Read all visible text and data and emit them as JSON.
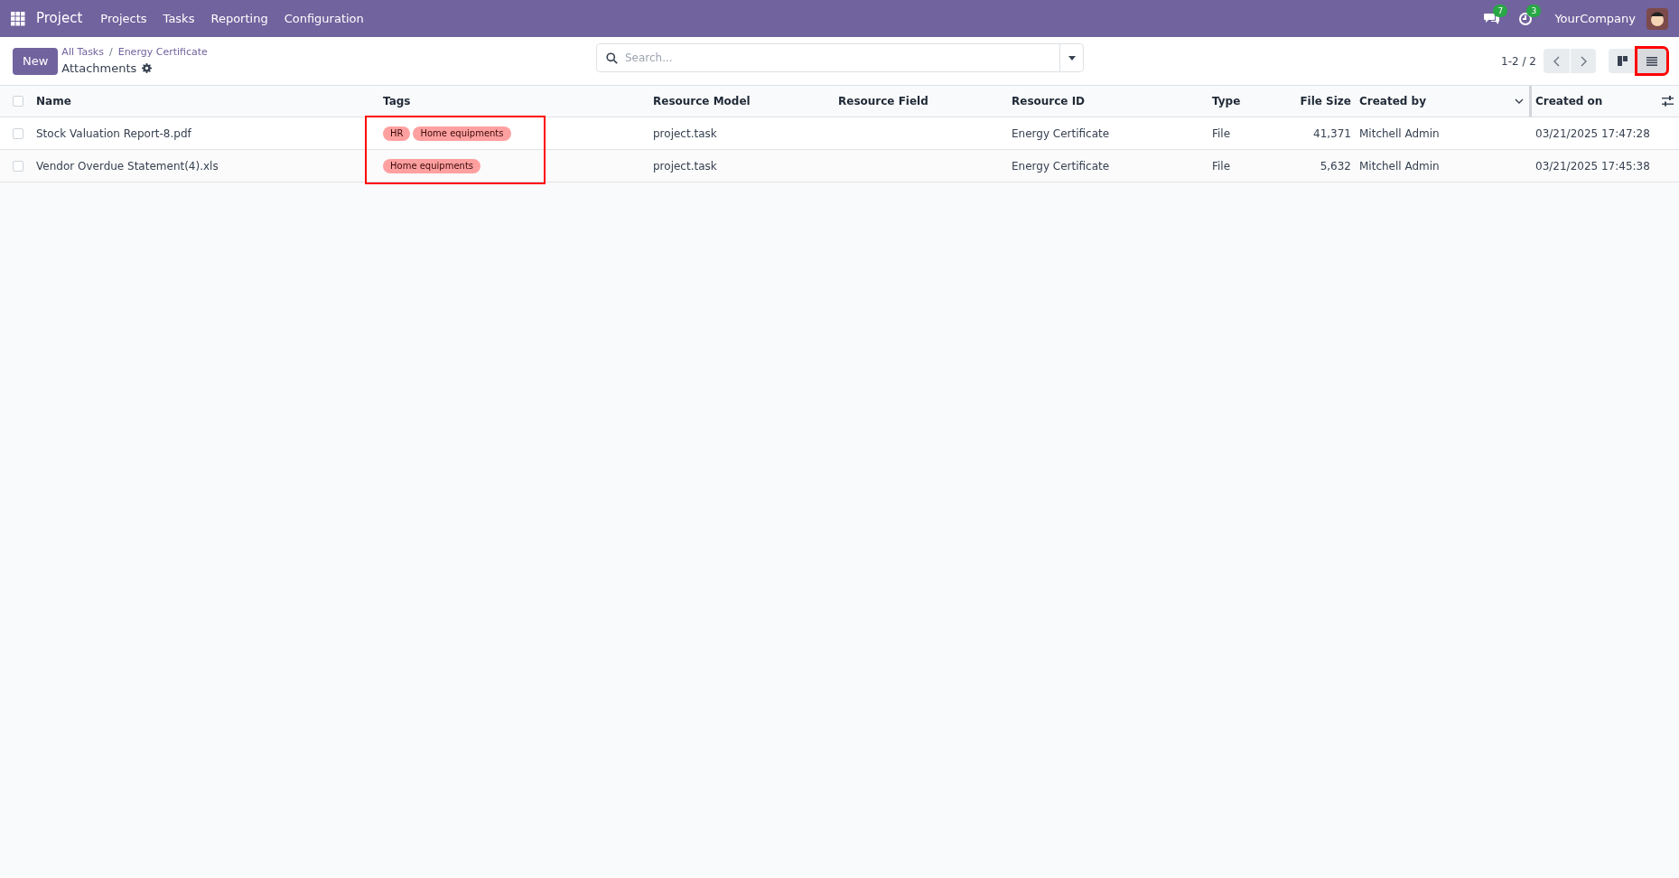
{
  "navbar": {
    "app_name": "Project",
    "menu": [
      "Projects",
      "Tasks",
      "Reporting",
      "Configuration"
    ],
    "messages_count": "7",
    "activities_count": "3",
    "company": "YourCompany"
  },
  "control_panel": {
    "new_button": "New",
    "breadcrumbs": [
      "All Tasks",
      "Energy Certificate"
    ],
    "breadcrumb_separator": "/",
    "title": "Attachments",
    "search": {
      "placeholder": "Search..."
    },
    "pager": "1-2 / 2",
    "views": [
      {
        "kind": "kanban",
        "selected": false,
        "highlighted": false
      },
      {
        "kind": "list",
        "selected": true,
        "highlighted": true
      }
    ]
  },
  "table": {
    "tags_highlighted": true,
    "all_selected": false,
    "columns": [
      "Name",
      "Tags",
      "Resource Model",
      "Resource Field",
      "Resource ID",
      "Type",
      "File Size",
      "Created by",
      "Created on"
    ],
    "rows": [
      {
        "checked": false,
        "name": "Stock Valuation Report-8.pdf",
        "tags": [
          "HR",
          "Home equipments"
        ],
        "resource_model": "project.task",
        "resource_id": "Energy Certificate",
        "type": "File",
        "file_size": "41,371",
        "created_by": "Mitchell Admin",
        "created_on": "03/21/2025 17:47:28"
      },
      {
        "checked": false,
        "name": "Vendor Overdue Statement(4).xls",
        "tags": [
          "Home equipments"
        ],
        "resource_model": "project.task",
        "resource_id": "Energy Certificate",
        "type": "File",
        "file_size": "5,632",
        "created_by": "Mitchell Admin",
        "created_on": "03/21/2025 17:45:38"
      }
    ]
  }
}
